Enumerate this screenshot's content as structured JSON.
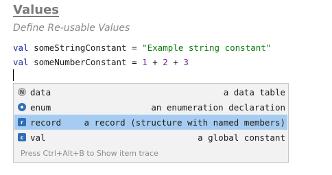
{
  "heading": "Values",
  "subheading": "Define Re-usable Values",
  "code": {
    "line1": {
      "keyword": "val",
      "name": "someStringConstant",
      "op": "=",
      "value": "\"Example string constant\""
    },
    "line2": {
      "keyword": "val",
      "name": "someNumberConstant",
      "op": "=",
      "n1": "1",
      "plus1": "+",
      "n2": "2",
      "plus2": "+",
      "n3": "3"
    }
  },
  "completion": {
    "items": [
      {
        "icon": "keyword-icon",
        "glyph": "N",
        "label": "data",
        "description": "a data table",
        "selected": false
      },
      {
        "icon": "enum-icon",
        "glyph": "",
        "label": "enum",
        "description": "an enumeration declaration",
        "selected": false
      },
      {
        "icon": "record-icon",
        "glyph": "r",
        "label": "record",
        "description": "a record (structure with named members)",
        "selected": true
      },
      {
        "icon": "val-icon",
        "glyph": "c",
        "label": "val",
        "description": "a global constant",
        "selected": false
      }
    ],
    "footer": "Press Ctrl+Alt+B to Show item trace"
  },
  "colors": {
    "keyword": "#1b2b9a",
    "string": "#0a7a0a",
    "number": "#7a1fa2",
    "selection": "#a6cdf1",
    "popup_bg": "#f2f2f2"
  }
}
